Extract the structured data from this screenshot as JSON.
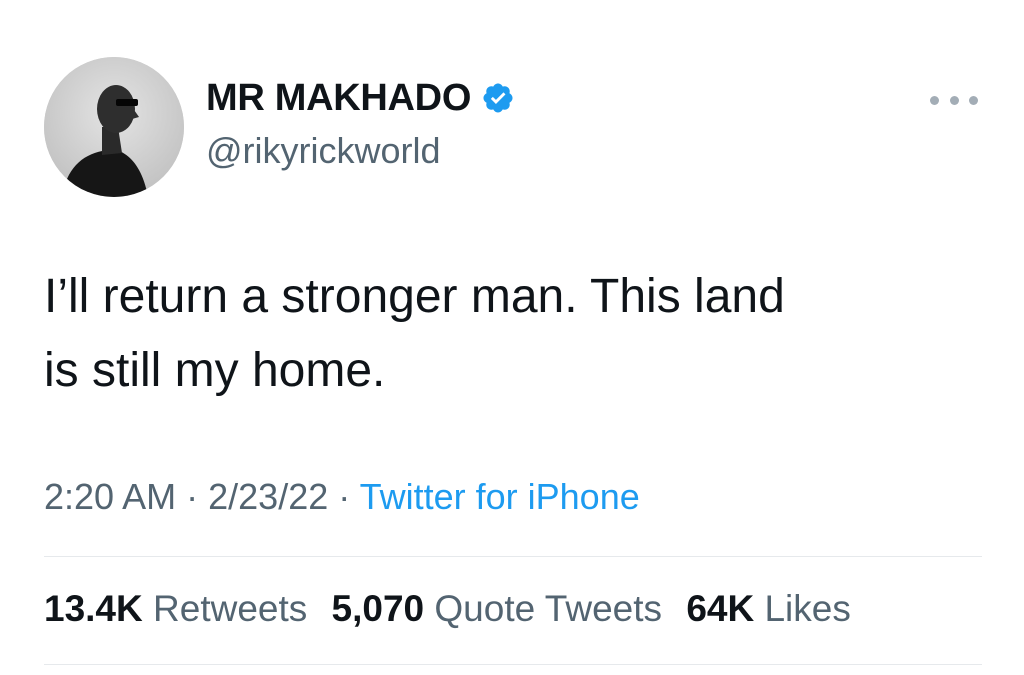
{
  "user": {
    "display_name": "MR MAKHADO",
    "handle": "@rikyrickworld",
    "verified": true,
    "avatar_icon": "profile-photo",
    "verified_icon": "verified-badge-icon"
  },
  "tweet": {
    "text": "I’ll return a stronger man. This land\nis still my home.",
    "time": "2:20 AM",
    "separator": "·",
    "date": "2/23/22",
    "source": "Twitter for iPhone"
  },
  "stats": [
    {
      "count": "13.4K",
      "label": "Retweets"
    },
    {
      "count": "5,070",
      "label": "Quote Tweets"
    },
    {
      "count": "64K",
      "label": "Likes"
    }
  ],
  "colors": {
    "text": "#0f1419",
    "secondary": "#536471",
    "link": "#1d9bf0",
    "verified": "#1d9bf0",
    "divider": "#e6e9ec"
  }
}
